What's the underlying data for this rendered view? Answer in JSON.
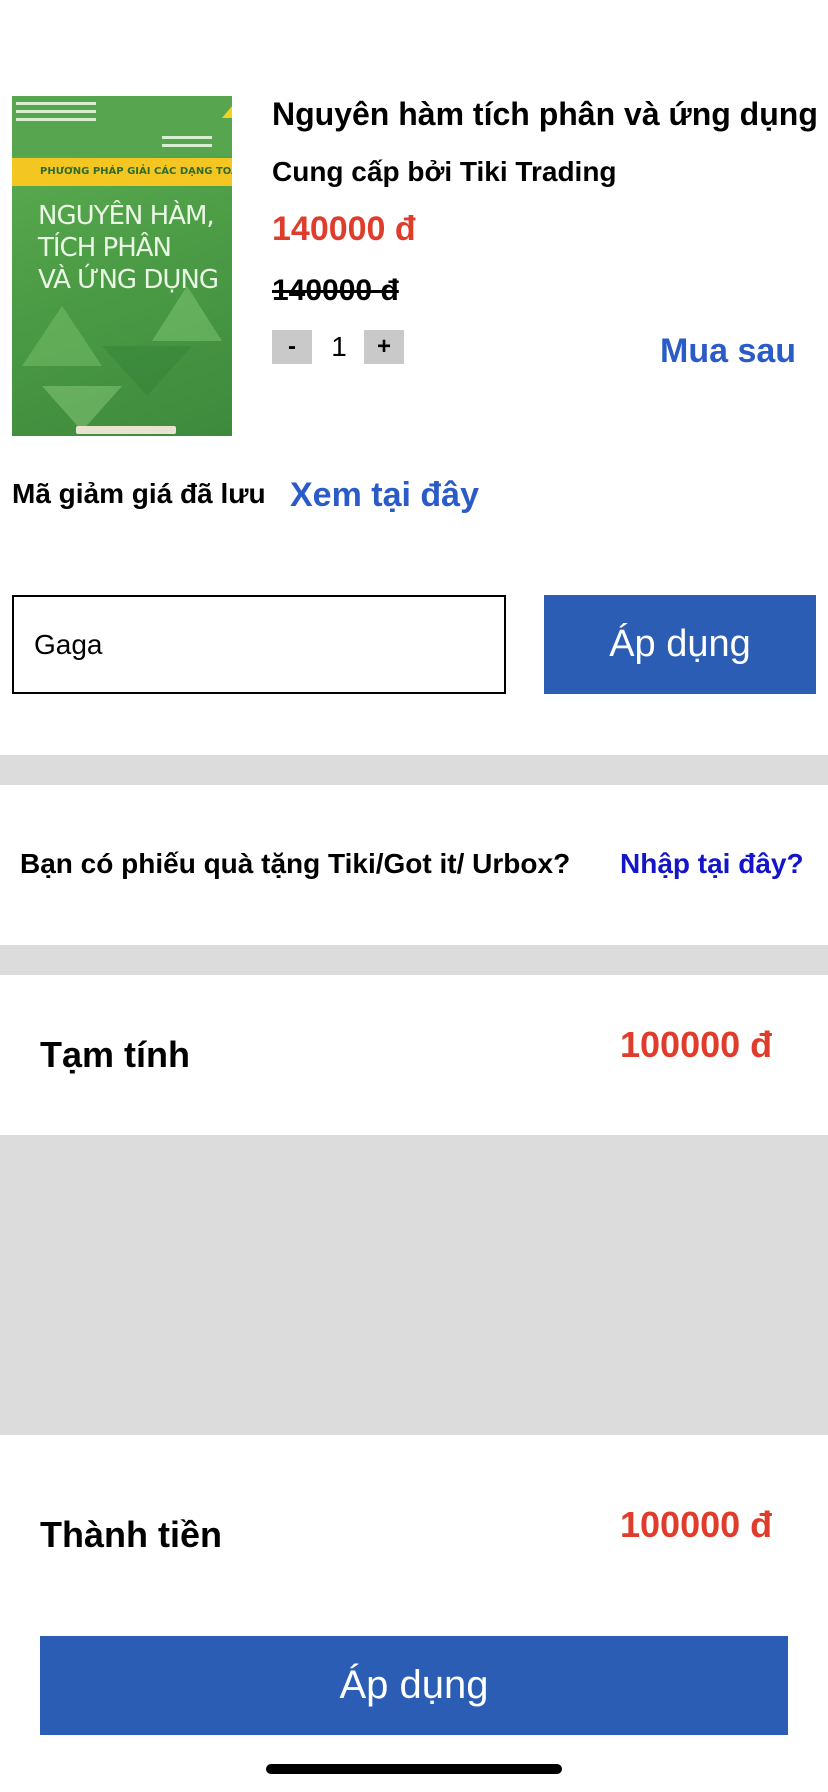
{
  "product": {
    "cover_band_text": "PHƯƠNG PHÁP GIẢI CÁC DẠNG TOÁN THPT",
    "cover_title": "NGUYÊN HÀM,\nTÍCH PHÂN\nVÀ ỨNG DỤNG",
    "title": "Nguyên hàm tích phân và ứng dụng",
    "provider": "Cung cấp bởi Tiki Trading",
    "price": "140000 đ",
    "old_price": "140000 đ",
    "quantity": "1",
    "minus_label": "-",
    "plus_label": "+",
    "buy_later_label": "Mua sau"
  },
  "coupon": {
    "saved_label": "Mã giảm giá đã lưu",
    "saved_link": "Xem tại đây",
    "input_value": "Gaga",
    "apply_label": "Áp dụng"
  },
  "gift": {
    "question": "Bạn có phiếu quà tặng Tiki/Got it/ Urbox?",
    "link": "Nhập tại đây?"
  },
  "summary": {
    "subtotal_label": "Tạm tính",
    "subtotal_value": "100000 đ",
    "total_label": "Thành tiền",
    "total_value": "100000 đ"
  },
  "footer": {
    "apply_label": "Áp dụng"
  },
  "colors": {
    "accent_blue": "#2b5db4",
    "link_blue": "#2a5bc7",
    "price_red": "#e03c2c",
    "divider_gray": "#dcdcdc"
  }
}
